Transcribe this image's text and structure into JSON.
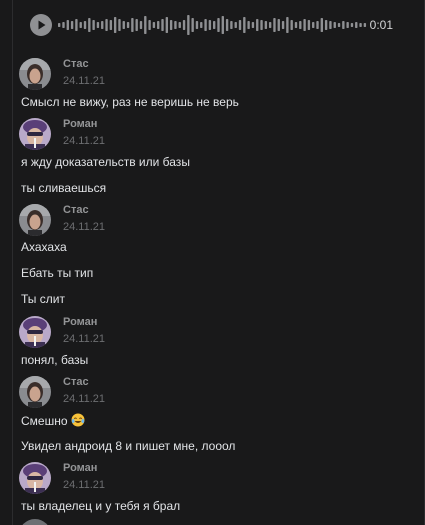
{
  "audio": {
    "duration": "0:01",
    "waveform": [
      2,
      3,
      5,
      4,
      6,
      3,
      4,
      7,
      5,
      3,
      4,
      6,
      5,
      8,
      6,
      4,
      3,
      7,
      6,
      4,
      9,
      5,
      3,
      4,
      6,
      8,
      5,
      4,
      3,
      5,
      10,
      7,
      4,
      3,
      6,
      5,
      4,
      7,
      9,
      6,
      4,
      3,
      5,
      8,
      4,
      3,
      6,
      5,
      4,
      3,
      7,
      6,
      4,
      8,
      5,
      3,
      4,
      6,
      5,
      3,
      4,
      7,
      5,
      4,
      3,
      2,
      4,
      3,
      2,
      3,
      2,
      2
    ]
  },
  "messages": [
    {
      "author": "Стас",
      "date": "24.11.21",
      "avatar": "stas",
      "lines": [
        "Смысл не вижу, раз не веришь не верь"
      ]
    },
    {
      "author": "Роман",
      "date": "24.11.21",
      "avatar": "roman",
      "lines": [
        "я жду доказательств или базы",
        "ты сливаешься"
      ]
    },
    {
      "author": "Стас",
      "date": "24.11.21",
      "avatar": "stas",
      "lines": [
        "Ахахаха",
        "Ебать ты тип",
        "Ты слит"
      ]
    },
    {
      "author": "Роман",
      "date": "24.11.21",
      "avatar": "roman",
      "lines": [
        "понял, базы"
      ]
    },
    {
      "author": "Стас",
      "date": "24.11.21",
      "avatar": "stas",
      "lines": [
        "Смешно",
        "Увидел андроид 8 и пишет мне, лооол"
      ],
      "emoji": "tears-of-joy-emoji"
    },
    {
      "author": "Роман",
      "date": "24.11.21",
      "avatar": "roman",
      "lines": [
        "ты владелец и у тебя я брал"
      ]
    }
  ]
}
